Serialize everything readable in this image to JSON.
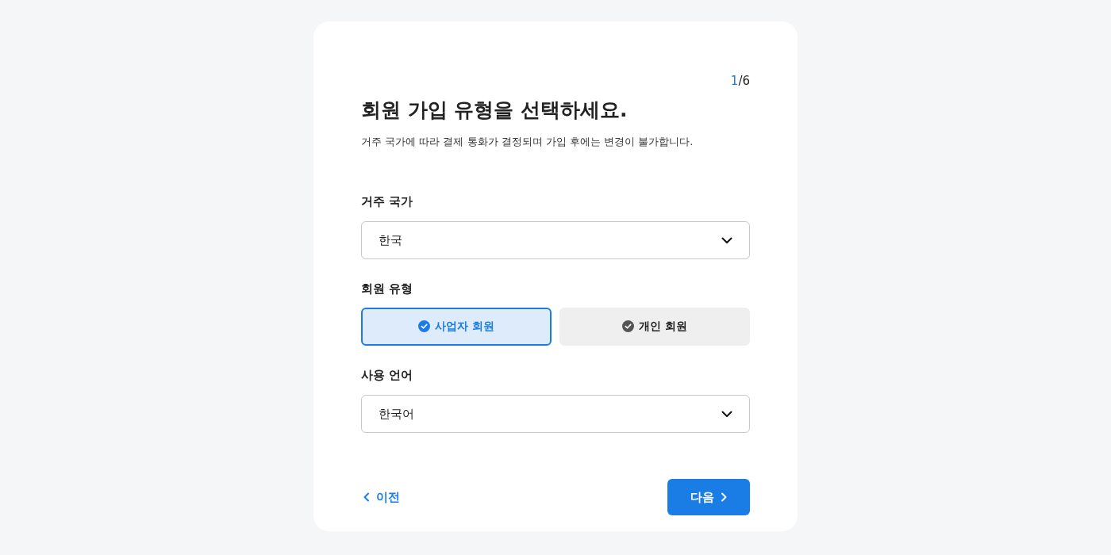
{
  "step": {
    "current": "1",
    "total": "/6"
  },
  "title": "회원 가입 유형을 선택하세요.",
  "description": "거주 국가에 따라 결제 통화가 결정되며 가입 후에는 변경이 불가합니다.",
  "country": {
    "label": "거주 국가",
    "value": "한국"
  },
  "member_type": {
    "label": "회원 유형",
    "options": [
      {
        "label": "사업자 회원",
        "selected": true
      },
      {
        "label": "개인 회원",
        "selected": false
      }
    ]
  },
  "language": {
    "label": "사용 언어",
    "value": "한국어"
  },
  "buttons": {
    "prev": "이전",
    "next": "다음"
  }
}
